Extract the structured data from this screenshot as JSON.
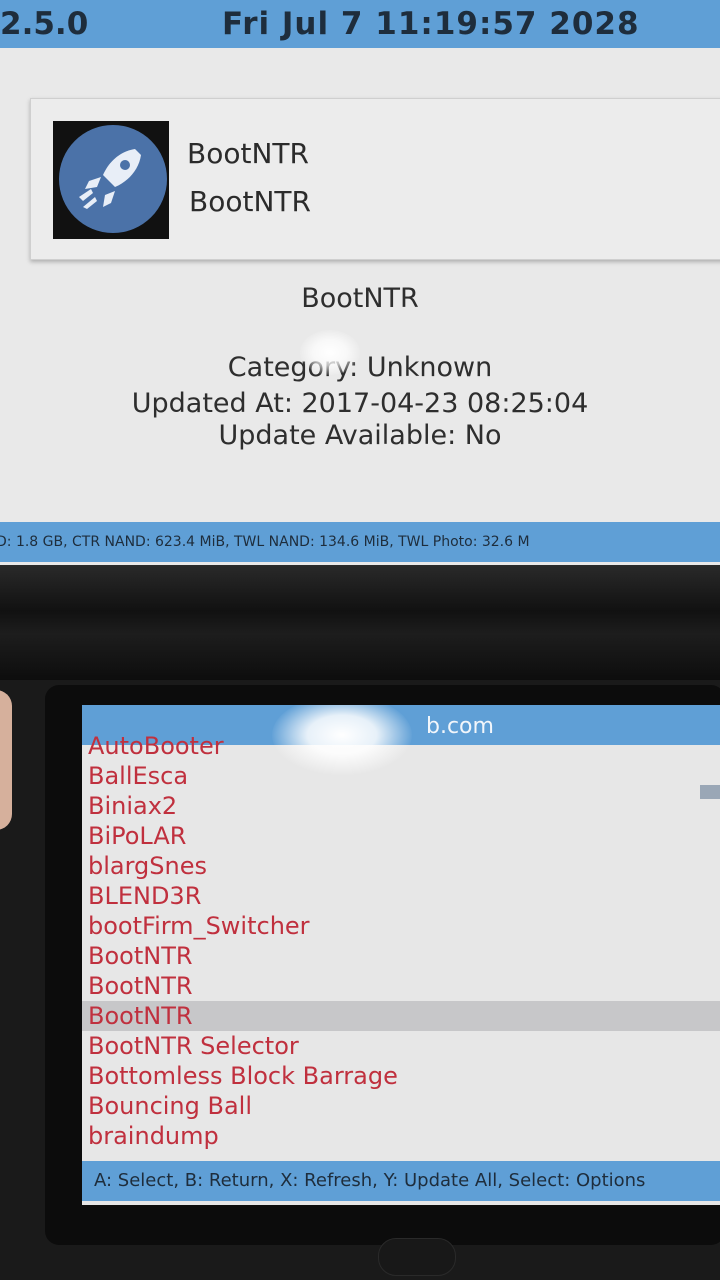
{
  "status_bar": {
    "version": "2.5.0",
    "datetime": "Fri Jul  7 11:19:57 2028"
  },
  "app_card": {
    "title": "BootNTR",
    "author": "BootNTR",
    "icon": "rocket-icon"
  },
  "details": {
    "name": "BootNTR",
    "category": "Category: Unknown",
    "updated_at": "Updated At: 2017-04-23 08:25:04",
    "update_available": "Update Available: No"
  },
  "storage_bar": {
    "text": "D: 1.8 GB, CTR NAND: 623.4 MiB, TWL NAND: 134.6 MiB, TWL Photo: 32.6 M"
  },
  "bottom": {
    "header_text": "b.com",
    "apps": [
      "AutoBooter",
      "BallEsca",
      "Biniax2",
      "BiPoLAR",
      "blargSnes",
      "BLEND3R",
      "bootFirm_Switcher",
      "BootNTR",
      "BootNTR",
      "BootNTR",
      "BootNTR Selector",
      "Bottomless Block Barrage",
      "Bouncing Ball",
      "braindump"
    ],
    "selected_index": 9,
    "hint": "A: Select, B: Return, X: Refresh, Y: Update All, Select: Options"
  },
  "colors": {
    "accent_bar": "#5f9fd6",
    "list_text": "#c0303e",
    "selection": "#c7c7c9",
    "icon_bg": "#4b72a8"
  }
}
